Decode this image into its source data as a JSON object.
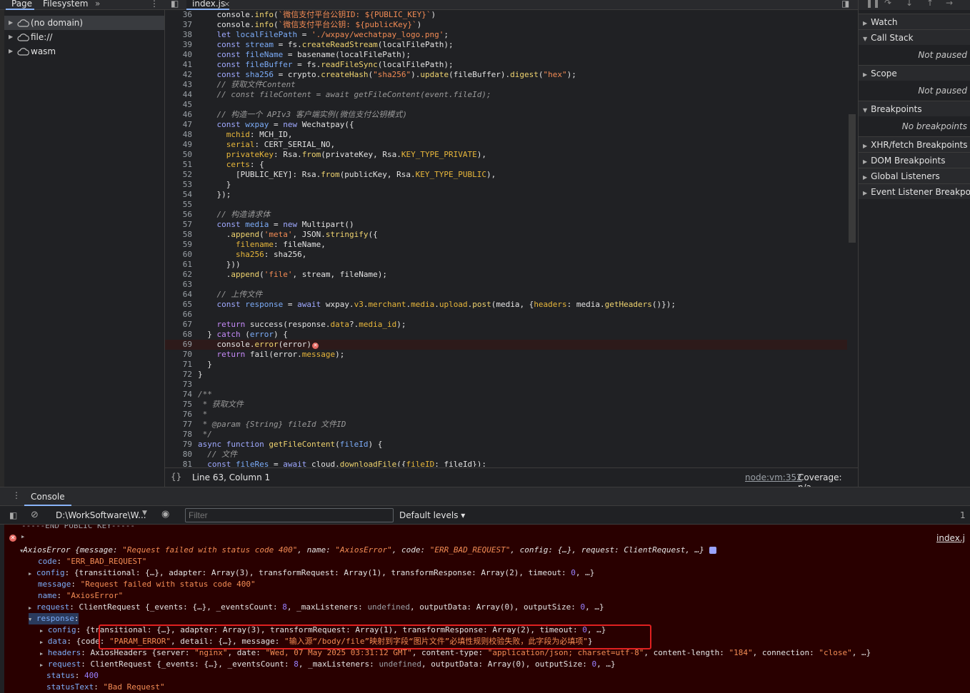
{
  "navigator": {
    "tabs": [
      "Page",
      "Filesystem"
    ],
    "more": "»",
    "menu": "⋮",
    "items": [
      "(no domain)",
      "file://",
      "wasm"
    ]
  },
  "editor": {
    "tab_label": "index.js",
    "tab_close": "×",
    "line_numbers": [
      "36",
      "37",
      "38",
      "39",
      "40",
      "41",
      "42",
      "43",
      "44",
      "45",
      "46",
      "47",
      "48",
      "49",
      "50",
      "51",
      "52",
      "53",
      "54",
      "55",
      "56",
      "57",
      "58",
      "59",
      "60",
      "61",
      "62",
      "63",
      "64",
      "65",
      "66",
      "67",
      "68",
      "69",
      "70",
      "71",
      "72",
      "73",
      "74",
      "75",
      "76",
      "77",
      "78",
      "79",
      "80",
      "81"
    ],
    "status": {
      "braces": "{}",
      "position": "Line 63, Column 1",
      "source_link": "node:vm:352",
      "coverage": "Coverage: n/a"
    }
  },
  "debugger": {
    "sections": [
      "Watch",
      "Call Stack",
      "Scope",
      "Breakpoints",
      "XHR/fetch Breakpoints",
      "DOM Breakpoints",
      "Global Listeners",
      "Event Listener Breakpoints"
    ],
    "call_stack_msg": "Not paused",
    "scope_msg": "Not paused",
    "breakpoints_msg": "No breakpoints"
  },
  "console": {
    "tab": "Console",
    "context": "D:\\WorkSoftware\\W...",
    "filter_placeholder": "Filter",
    "levels": "Default levels",
    "issues_count": "1",
    "source": "index.j",
    "truncated_line": "-----END PUBLIC KEY-----"
  }
}
